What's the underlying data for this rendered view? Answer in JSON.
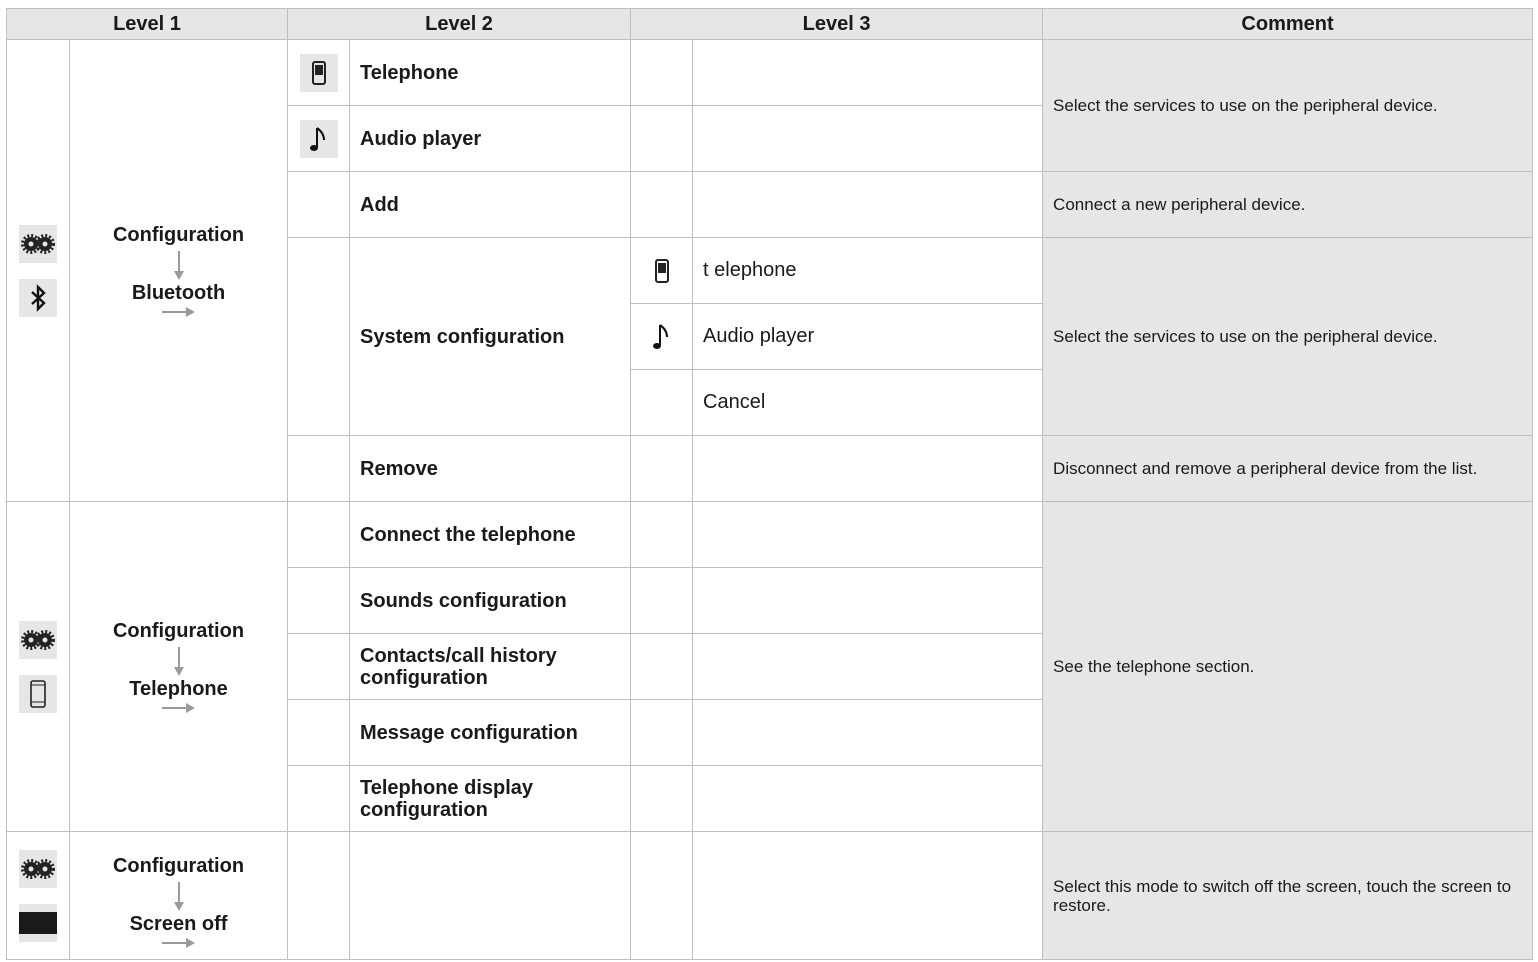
{
  "headers": {
    "level1": "Level 1",
    "level2": "Level 2",
    "level3": "Level 3",
    "comment": "Comment"
  },
  "sections": [
    {
      "level1": {
        "title": "Configuration",
        "sub": "Bluetooth",
        "icons": [
          "gears-icon",
          "bluetooth-icon"
        ]
      },
      "rows": [
        {
          "l2_icon": "phone-icon",
          "l2": "Telephone",
          "l3_icon": "",
          "l3": ""
        },
        {
          "l2_icon": "music-note-icon",
          "l2": "Audio player",
          "l3_icon": "",
          "l3": ""
        },
        {
          "l2_icon": "",
          "l2": "Add",
          "l3_icon": "",
          "l3": ""
        },
        {
          "l2_icon": "",
          "l2": "System configuration",
          "l3_icon": "phone-icon",
          "l3": "t elephone"
        },
        {
          "l3_icon": "music-note-icon",
          "l3": "Audio player"
        },
        {
          "l3_icon": "",
          "l3": "Cancel"
        },
        {
          "l2_icon": "",
          "l2": "Remove",
          "l3_icon": "",
          "l3": ""
        }
      ],
      "comments": [
        "Select the services to use on the peripheral device.",
        "Connect a new peripheral device.",
        "Select the services to use on the peripheral device.",
        "Disconnect and remove a peripheral device from the list."
      ]
    },
    {
      "level1": {
        "title": "Configuration",
        "sub": "Telephone",
        "icons": [
          "gears-icon",
          "smartphone-icon"
        ]
      },
      "rows": [
        {
          "l2": "Connect the telephone"
        },
        {
          "l2": "Sounds configuration"
        },
        {
          "l2": "Contacts/call history configuration"
        },
        {
          "l2": "Message configuration"
        },
        {
          "l2": "Telephone display configuration"
        }
      ],
      "comments": [
        "See the telephone section."
      ]
    },
    {
      "level1": {
        "title": "Configuration",
        "sub": "Screen off",
        "icons": [
          "gears-icon",
          "screen-off-icon"
        ]
      },
      "rows": [
        {
          "l2": ""
        }
      ],
      "comments": [
        "Select this mode to switch off the screen, touch the screen to restore."
      ]
    }
  ],
  "colors": {
    "header_bg": "#e6e6e6",
    "border": "#bfbfbf",
    "arrow": "#9a9a9a"
  }
}
